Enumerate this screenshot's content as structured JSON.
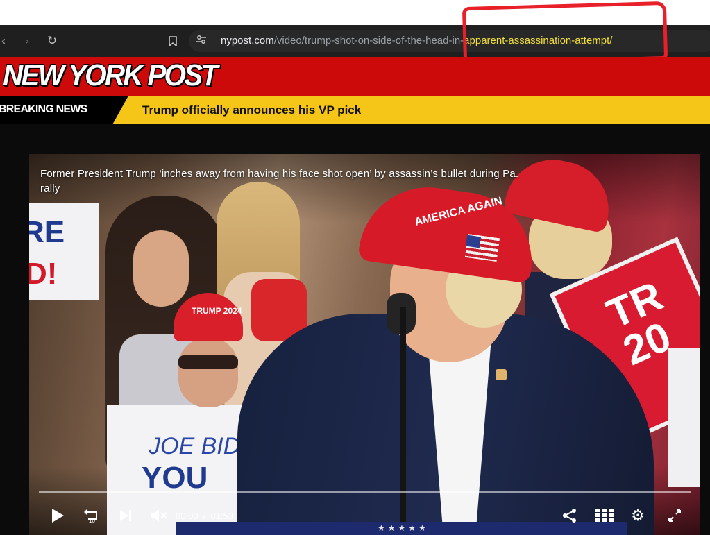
{
  "browser": {
    "url_domain": "nypost.com",
    "url_path_before": "/video/trump-shot-on-side-of-the-hea",
    "url_path_mid": "d-in-",
    "url_path_highlight": "apparent-assassination-attempt/",
    "icons": {
      "back": "chevron-left-icon",
      "forward": "chevron-right-icon",
      "reload": "reload-icon",
      "bookmark": "bookmark-icon",
      "site_info": "tune-icon"
    }
  },
  "site": {
    "logo": "NEW YORK POST",
    "breaking_label": "BREAKING NEWS",
    "breaking_headline": "Trump officially announces his VP pick"
  },
  "video": {
    "caption": "Former President Trump ‘inches away from having his face shot open’ by assassin’s bullet during Pa. rally",
    "current_time": "00:00",
    "separator": "/",
    "duration": "01:53",
    "progress_fraction": 0.0,
    "rewind_seconds": "10"
  },
  "scene_text": {
    "sign_left_a": "RE",
    "sign_left_b": "D!",
    "cap_girl": "TRUMP 2024",
    "man_cap": "AMERICA AGAIN",
    "sign_right": "TR 20",
    "sign_bottom_a": "JOE BID",
    "sign_bottom_b": "YOU",
    "podium_stars": "★★★★★"
  },
  "colors": {
    "masthead_red": "#cc0a0a",
    "breaking_yellow": "#f5c518",
    "url_highlight": "#f2de3a",
    "annotation_red": "#e8202a"
  }
}
